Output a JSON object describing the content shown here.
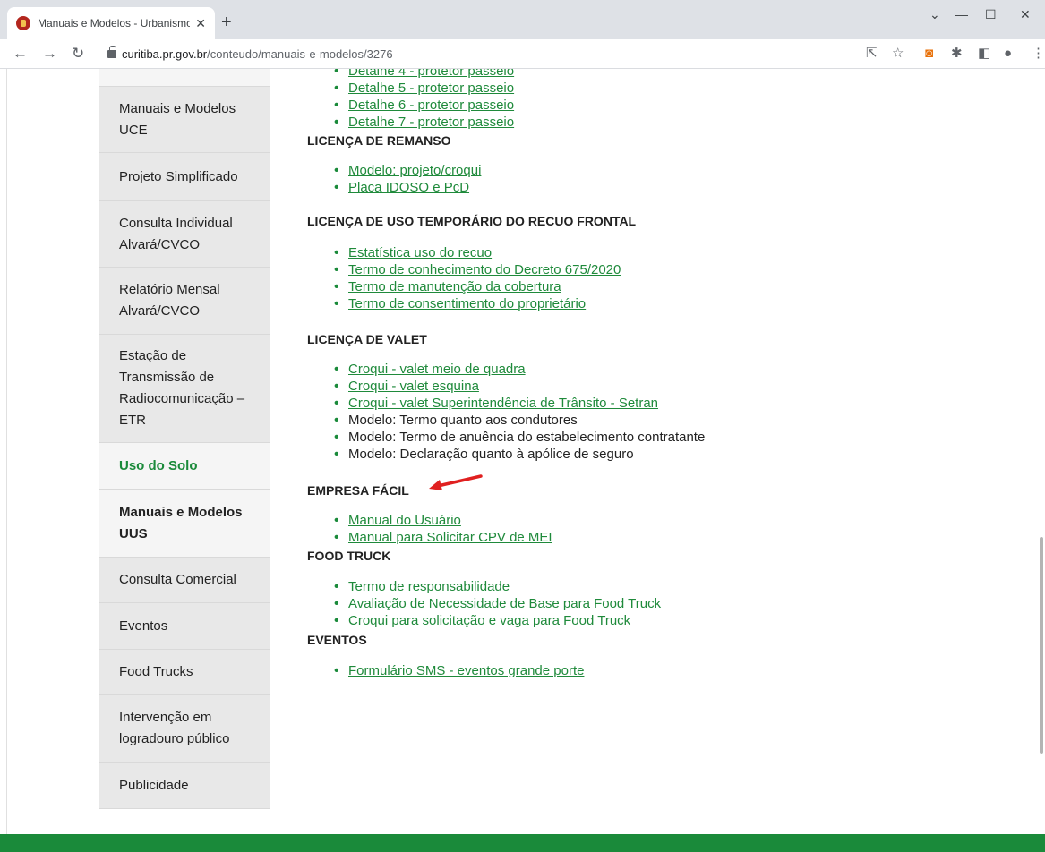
{
  "browser": {
    "tab_title": "Manuais e Modelos - Urbanismo",
    "tab_close": "✕",
    "new_tab": "+",
    "url_domain": "curitiba.pr.gov.br",
    "url_path": "/conteudo/manuais-e-modelos/3276",
    "window_controls": [
      "⌄",
      "—",
      "☐",
      "✕"
    ]
  },
  "sidebar": {
    "items": [
      {
        "label": "Manuais e Modelos UCE"
      },
      {
        "label": "Projeto Simplificado"
      },
      {
        "label": "Consulta Individual Alvará/CVCO"
      },
      {
        "label": "Relatório Mensal Alvará/CVCO"
      },
      {
        "label": "Estação de Transmissão de Radiocomunicação – ETR"
      },
      {
        "label": "Uso do Solo"
      },
      {
        "label": "Manuais e Modelos UUS"
      },
      {
        "label": "Consulta Comercial"
      },
      {
        "label": "Eventos"
      },
      {
        "label": "Food Trucks"
      },
      {
        "label": "Intervenção em logradouro público"
      },
      {
        "label": "Publicidade"
      }
    ]
  },
  "content": {
    "cut_top_link": "Detalhe 4 - protetor passeio",
    "detalhe_links": [
      "Detalhe 5 - protetor passeio",
      "Detalhe 6 - protetor passeio",
      "Detalhe 7 - protetor passeio"
    ],
    "sections": [
      {
        "heading": "LICENÇA DE REMANSO",
        "items": [
          "Modelo: projeto/croqui",
          "Placa IDOSO e PcD"
        ]
      },
      {
        "heading": "LICENÇA DE USO TEMPORÁRIO DO RECUO FRONTAL",
        "items": [
          "Estatística uso do recuo",
          "Termo de conhecimento do Decreto 675/2020",
          "Termo de manutenção da cobertura",
          "Termo de consentimento do proprietário"
        ]
      },
      {
        "heading": "LICENÇA DE VALET",
        "items": [
          "Croqui - valet  meio de quadra",
          "Croqui - valet esquina",
          "Croqui - valet Superintendência de Trânsito - Setran",
          "Modelo: Termo quanto aos condutores",
          "Modelo: Termo de anuência do estabelecimento contratante",
          "Modelo: Declaração quanto à apólice de seguro"
        ]
      },
      {
        "heading": "EMPRESA FÁCIL",
        "items": [
          "Manual do Usuário",
          "Manual para Solicitar CPV de MEI"
        ]
      },
      {
        "heading": "FOOD TRUCK",
        "items": [
          "Termo de responsabilidade",
          "Avaliação de Necessidade de Base para Food Truck",
          "Croqui para solicitação e vaga para Food Truck"
        ]
      },
      {
        "heading": "EVENTOS",
        "items": [
          "Formulário SMS - eventos grande porte"
        ]
      }
    ]
  },
  "colors": {
    "accent_green": "#1a8a3a",
    "link_green": "#1f8a3b",
    "annotation_arrow": "#e02020"
  }
}
